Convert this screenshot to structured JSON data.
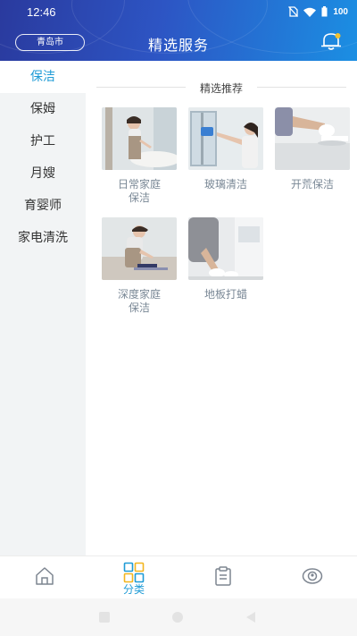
{
  "status": {
    "time": "12:46",
    "battery": "100"
  },
  "header": {
    "city": "青岛市",
    "title": "精选服务"
  },
  "sidebar": {
    "items": [
      {
        "label": "保洁"
      },
      {
        "label": "保姆"
      },
      {
        "label": "护工"
      },
      {
        "label": "月嫂"
      },
      {
        "label": "育婴师"
      },
      {
        "label": "家电清洗"
      }
    ]
  },
  "main": {
    "section_title": "精选推荐",
    "services": [
      {
        "label": "日常家庭保洁"
      },
      {
        "label": "玻璃清洁"
      },
      {
        "label": "开荒保洁"
      },
      {
        "label": "深度家庭保洁"
      },
      {
        "label": "地板打蜡"
      }
    ]
  },
  "tabbar": {
    "active_label": "分类"
  },
  "colors": {
    "accent": "#1f9bd6",
    "header_start": "#2a3a9e",
    "header_end": "#1b8fe3",
    "sidebar_bg": "#f2f4f5"
  }
}
